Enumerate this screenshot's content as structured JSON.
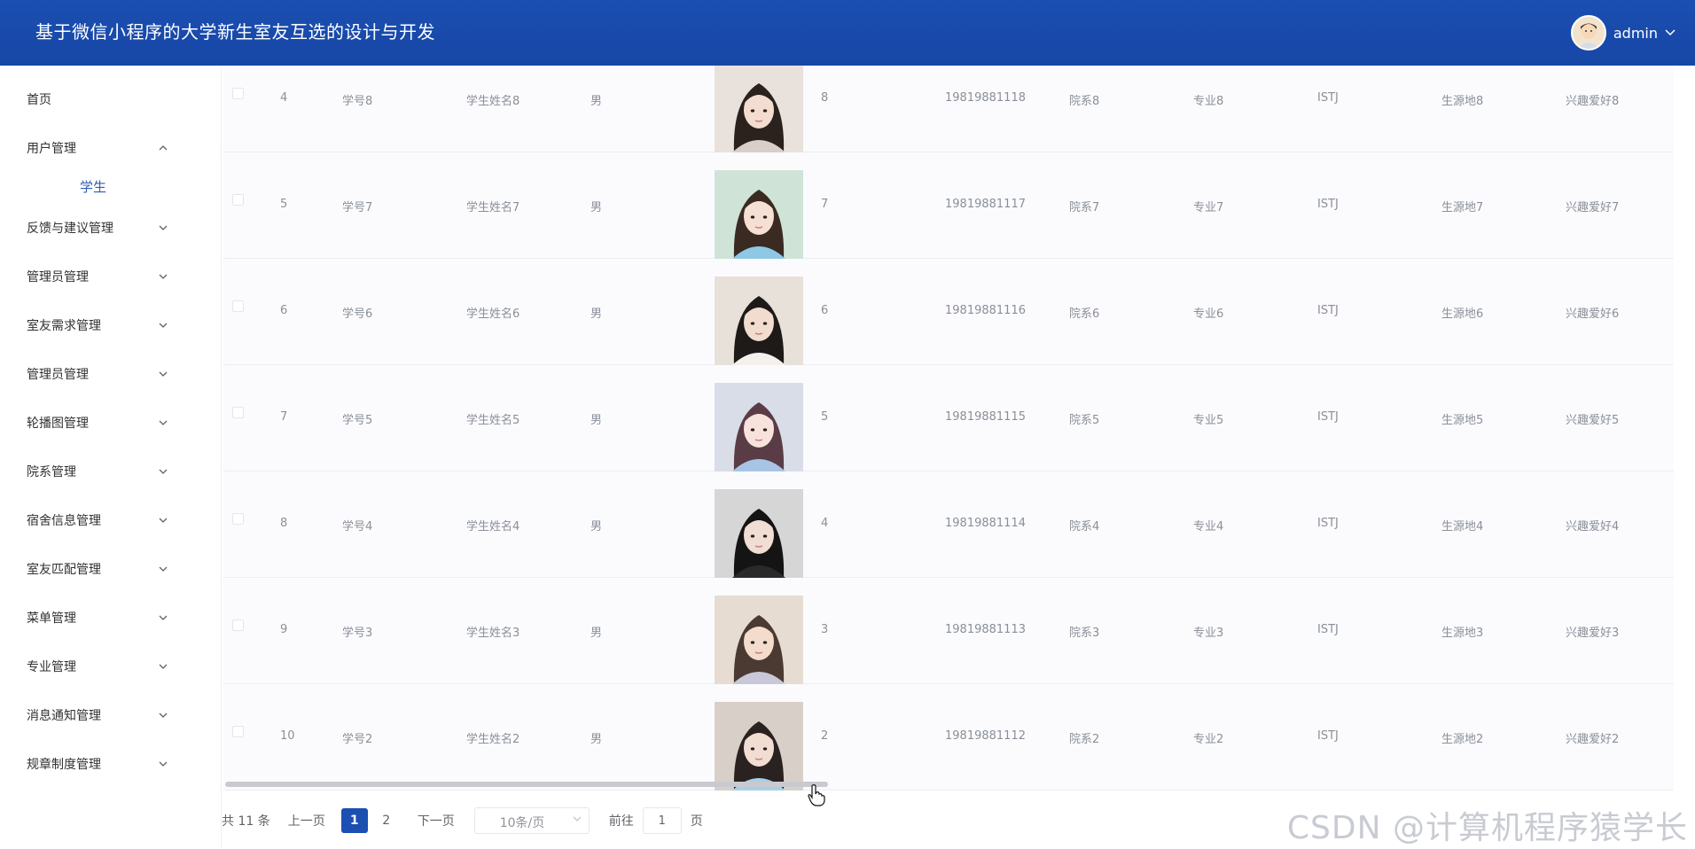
{
  "header": {
    "title": "基于微信小程序的大学新生室友互选的设计与开发",
    "user_name": "admin"
  },
  "sidebar": {
    "items": [
      {
        "label": "首页",
        "has_arrow": false,
        "expanded": false
      },
      {
        "label": "用户管理",
        "has_arrow": true,
        "expanded": true,
        "children": [
          "学生"
        ]
      },
      {
        "label": "反馈与建议管理",
        "has_arrow": true,
        "expanded": false
      },
      {
        "label": "管理员管理",
        "has_arrow": true,
        "expanded": false
      },
      {
        "label": "室友需求管理",
        "has_arrow": true,
        "expanded": false
      },
      {
        "label": "管理员管理",
        "has_arrow": true,
        "expanded": false
      },
      {
        "label": "轮播图管理",
        "has_arrow": true,
        "expanded": false
      },
      {
        "label": "院系管理",
        "has_arrow": true,
        "expanded": false
      },
      {
        "label": "宿舍信息管理",
        "has_arrow": true,
        "expanded": false
      },
      {
        "label": "室友匹配管理",
        "has_arrow": true,
        "expanded": false
      },
      {
        "label": "菜单管理",
        "has_arrow": true,
        "expanded": false
      },
      {
        "label": "专业管理",
        "has_arrow": true,
        "expanded": false
      },
      {
        "label": "消息通知管理",
        "has_arrow": true,
        "expanded": false
      },
      {
        "label": "规章制度管理",
        "has_arrow": true,
        "expanded": false
      }
    ]
  },
  "table": {
    "rows": [
      {
        "index": "4",
        "student_no": "学号8",
        "name": "学生姓名8",
        "gender": "男",
        "photo": "portrait-8",
        "n": "8",
        "phone": "19819881118",
        "dept": "院系8",
        "major": "专业8",
        "mbti": "ISTJ",
        "origin": "生源地8",
        "hobby": "兴趣爱好8"
      },
      {
        "index": "5",
        "student_no": "学号7",
        "name": "学生姓名7",
        "gender": "男",
        "photo": "portrait-7",
        "n": "7",
        "phone": "19819881117",
        "dept": "院系7",
        "major": "专业7",
        "mbti": "ISTJ",
        "origin": "生源地7",
        "hobby": "兴趣爱好7"
      },
      {
        "index": "6",
        "student_no": "学号6",
        "name": "学生姓名6",
        "gender": "男",
        "photo": "portrait-6",
        "n": "6",
        "phone": "19819881116",
        "dept": "院系6",
        "major": "专业6",
        "mbti": "ISTJ",
        "origin": "生源地6",
        "hobby": "兴趣爱好6"
      },
      {
        "index": "7",
        "student_no": "学号5",
        "name": "学生姓名5",
        "gender": "男",
        "photo": "portrait-5",
        "n": "5",
        "phone": "19819881115",
        "dept": "院系5",
        "major": "专业5",
        "mbti": "ISTJ",
        "origin": "生源地5",
        "hobby": "兴趣爱好5"
      },
      {
        "index": "8",
        "student_no": "学号4",
        "name": "学生姓名4",
        "gender": "男",
        "photo": "portrait-4",
        "n": "4",
        "phone": "19819881114",
        "dept": "院系4",
        "major": "专业4",
        "mbti": "ISTJ",
        "origin": "生源地4",
        "hobby": "兴趣爱好4"
      },
      {
        "index": "9",
        "student_no": "学号3",
        "name": "学生姓名3",
        "gender": "男",
        "photo": "portrait-3",
        "n": "3",
        "phone": "19819881113",
        "dept": "院系3",
        "major": "专业3",
        "mbti": "ISTJ",
        "origin": "生源地3",
        "hobby": "兴趣爱好3"
      },
      {
        "index": "10",
        "student_no": "学号2",
        "name": "学生姓名2",
        "gender": "男",
        "photo": "portrait-2",
        "n": "2",
        "phone": "19819881112",
        "dept": "院系2",
        "major": "专业2",
        "mbti": "ISTJ",
        "origin": "生源地2",
        "hobby": "兴趣爱好2"
      }
    ]
  },
  "pagination": {
    "total": "共 11 条",
    "prev": "上一页",
    "pages": [
      "1",
      "2"
    ],
    "current_page": "1",
    "next": "下一页",
    "page_size": "10条/页",
    "goto_label": "前往",
    "goto_value": "1",
    "page_word": "页"
  },
  "watermark": "CSDN @计算机程序猿学长",
  "colors": {
    "header_bg": "#1b4fb1",
    "active_page": "#1b4fb1",
    "submenu_active": "#2f5fb8"
  }
}
